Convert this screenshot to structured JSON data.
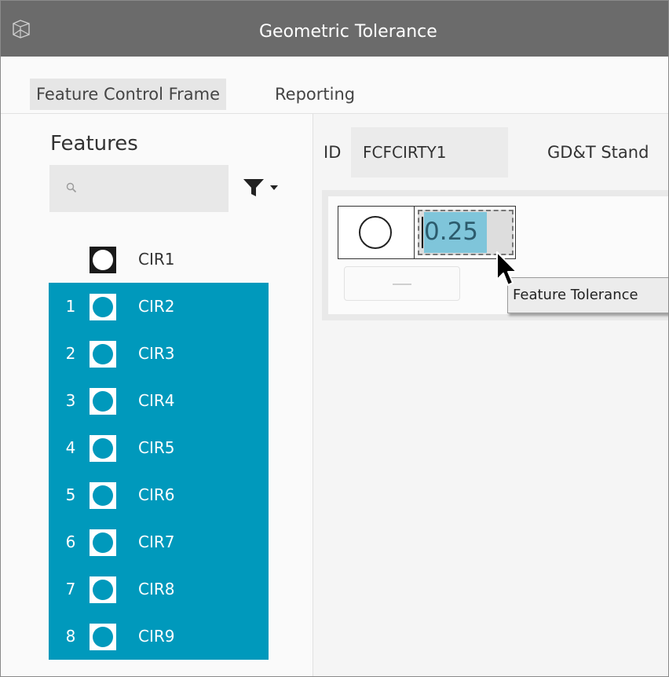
{
  "window": {
    "title": "Geometric Tolerance",
    "logo_icon": "app-logo-icon"
  },
  "tabs": [
    {
      "label": "Feature Control Frame",
      "active": true
    },
    {
      "label": "Reporting",
      "active": false
    }
  ],
  "features": {
    "title": "Features",
    "search": {
      "placeholder": "",
      "value": ""
    },
    "filter_icon": "filter-icon",
    "items": [
      {
        "number": "",
        "label": "CIR1",
        "selected": false
      },
      {
        "number": "1",
        "label": "CIR2",
        "selected": true
      },
      {
        "number": "2",
        "label": "CIR3",
        "selected": true
      },
      {
        "number": "3",
        "label": "CIR4",
        "selected": true
      },
      {
        "number": "4",
        "label": "CIR5",
        "selected": true
      },
      {
        "number": "5",
        "label": "CIR6",
        "selected": true
      },
      {
        "number": "6",
        "label": "CIR7",
        "selected": true
      },
      {
        "number": "7",
        "label": "CIR8",
        "selected": true
      },
      {
        "number": "8",
        "label": "CIR9",
        "selected": true
      }
    ]
  },
  "fcf": {
    "id_label": "ID",
    "id_value": "FCFCIRTY1",
    "standard_label": "GD&T Stand",
    "tolerance_symbol": "circularity-icon",
    "tolerance_value": "0.25",
    "datum_placeholder": "—",
    "tooltip": "Feature Tolerance"
  },
  "colors": {
    "selection": "#0099bc",
    "titlebar": "#6b6b6b",
    "highlight": "#7fc5da"
  }
}
